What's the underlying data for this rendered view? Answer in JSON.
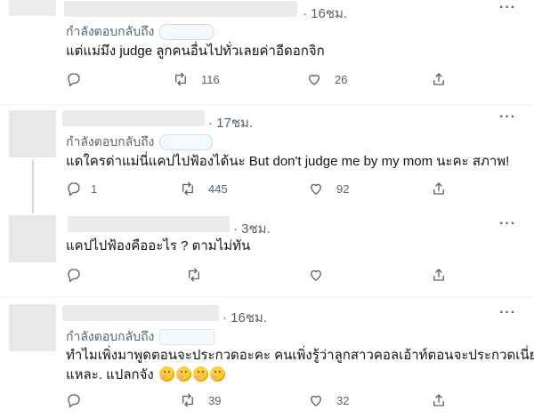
{
  "replying_label": "กำลังตอบกลับถึง",
  "tweets": [
    {
      "time": "· 16ชม.",
      "text": "แต่แม่มึง judge ลูกคนอื่นไปทั่วเลยค่าอีดอกจิก",
      "replies": "",
      "retweets": "116",
      "likes": "26"
    },
    {
      "time": "· 17ชม.",
      "text": "แดใครด่าแม่นี่แคปไปฟ้องได้นะ But don't judge me by my mom นะคะ สภาพ!",
      "replies": "1",
      "retweets": "445",
      "likes": "92"
    },
    {
      "time": "· 3ชม.",
      "text": "แคปไปฟ้องคืออะไร ? ตามไม่ทัน",
      "replies": "",
      "retweets": "",
      "likes": ""
    },
    {
      "time": "· 16ชม.",
      "text_line1": "ทำไมเพิ่งมาพูดตอนจะประกวดอะคะ คนเพิ่งรู้ว่าลูกสาวคอลเอ้าท์ตอนจะประกวดเนี่ย",
      "text_line2": "แหละ. แปลกจัง",
      "emoji": "thinking-face x4",
      "replies": "",
      "retweets": "39",
      "likes": "32"
    }
  ],
  "more_glyph": "···",
  "colors": {
    "secondary_text": "#536471",
    "divider": "#eff3f4",
    "thread_line": "#cfd9de"
  }
}
